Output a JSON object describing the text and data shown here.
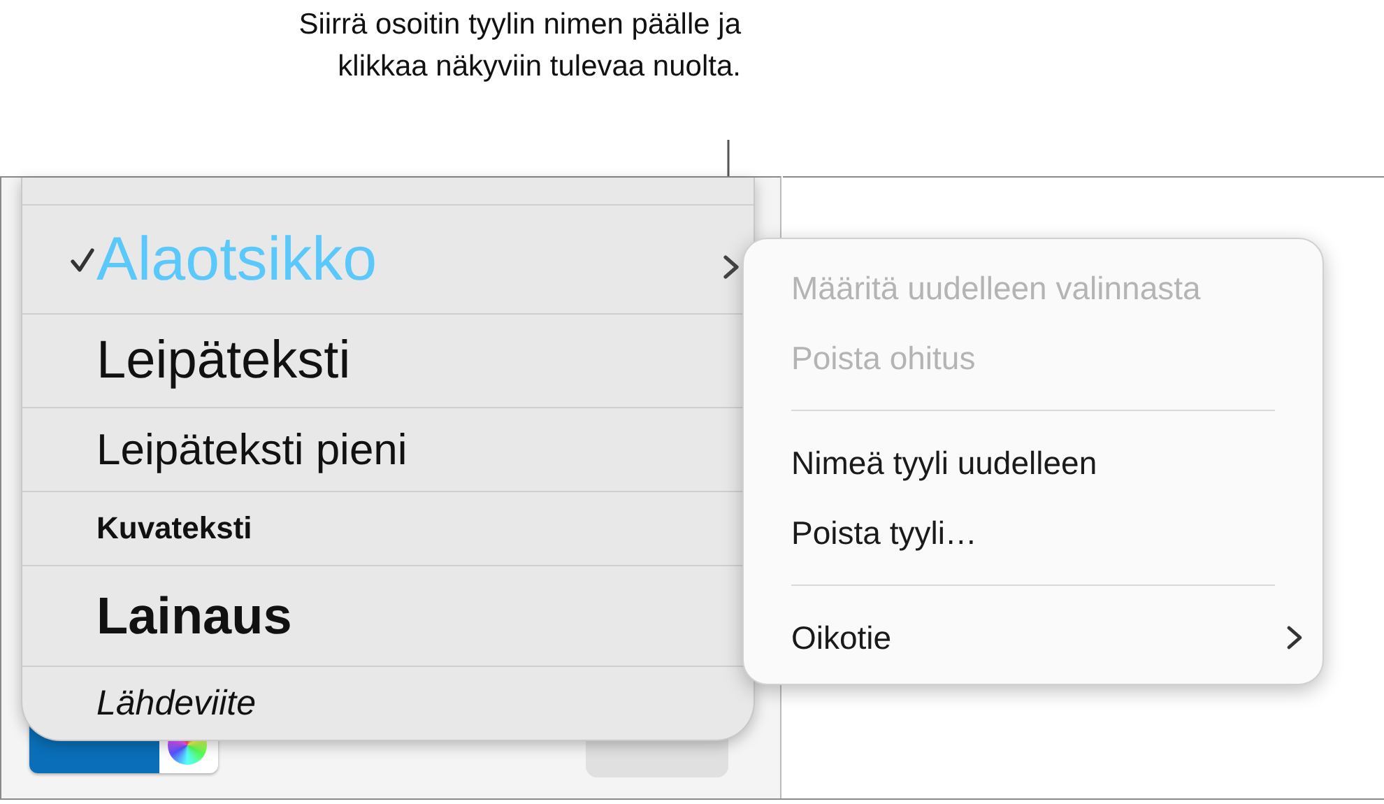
{
  "callout": {
    "text": "Siirrä osoitin tyylin nimen päälle ja klikkaa näkyviin tulevaa nuolta."
  },
  "inspector": {
    "color_well": {
      "color": "#0a6fb8"
    }
  },
  "styles_list": [
    {
      "label": "Alaotsikko",
      "kind": "subtitle",
      "selected": true
    },
    {
      "label": "Leipäteksti",
      "kind": "body",
      "selected": false
    },
    {
      "label": "Leipäteksti pieni",
      "kind": "body-small",
      "selected": false
    },
    {
      "label": "Kuvateksti",
      "kind": "caption",
      "selected": false
    },
    {
      "label": "Lainaus",
      "kind": "quote",
      "selected": false
    },
    {
      "label": "Lähdeviite",
      "kind": "citation",
      "selected": false
    }
  ],
  "context_menu": {
    "groups": [
      [
        {
          "label": "Määritä uudelleen valinnasta",
          "disabled": true,
          "submenu": false
        },
        {
          "label": "Poista ohitus",
          "disabled": true,
          "submenu": false
        }
      ],
      [
        {
          "label": "Nimeä tyyli uudelleen",
          "disabled": false,
          "submenu": false
        },
        {
          "label": "Poista tyyli…",
          "disabled": false,
          "submenu": false
        }
      ],
      [
        {
          "label": "Oikotie",
          "disabled": false,
          "submenu": true
        }
      ]
    ]
  }
}
